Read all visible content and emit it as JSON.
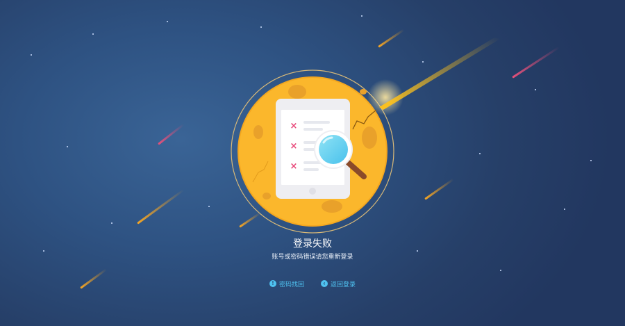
{
  "result": {
    "title": "登录失败",
    "message": "账号或密码错误请您重新登录"
  },
  "actions": {
    "recover_password": {
      "label": "密码找回",
      "icon": "exclamation-icon"
    },
    "back_to_login": {
      "label": "返回登录",
      "icon": "chevron-left-icon"
    }
  },
  "illustration": {
    "icon": "moon-tablet-magnifier-illustration",
    "list_marks": [
      "×",
      "×",
      "×"
    ]
  },
  "colors": {
    "background": "#2b4a78",
    "moon": "#fbb72c",
    "accent": "#4fc2f0",
    "meteor_orange": "#f6a623",
    "meteor_pink": "#e8507a"
  }
}
